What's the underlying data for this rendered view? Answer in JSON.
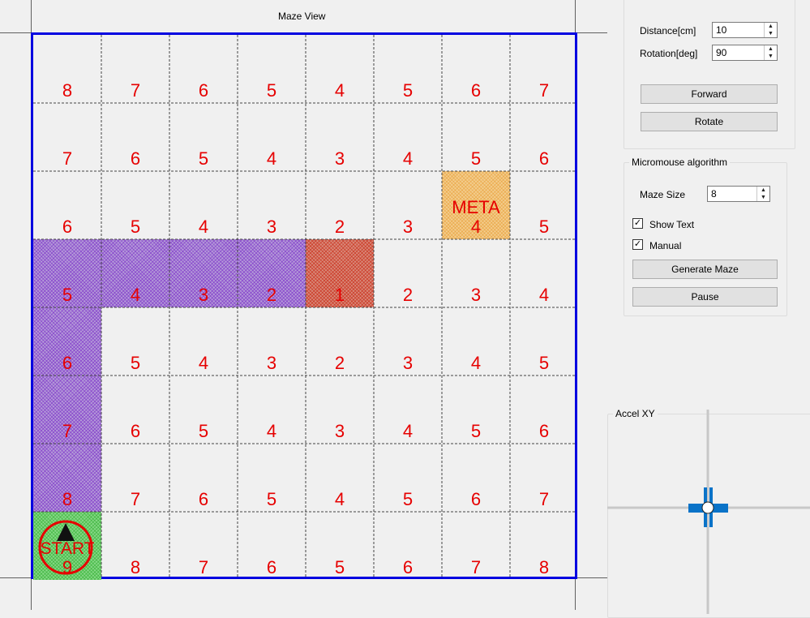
{
  "maze_view": {
    "title": "Maze View",
    "grid": [
      [
        8,
        7,
        6,
        5,
        4,
        5,
        6,
        7
      ],
      [
        7,
        6,
        5,
        4,
        3,
        4,
        5,
        6
      ],
      [
        6,
        5,
        4,
        3,
        2,
        3,
        4,
        5
      ],
      [
        5,
        4,
        3,
        2,
        1,
        2,
        3,
        4
      ],
      [
        6,
        5,
        4,
        3,
        2,
        3,
        4,
        5
      ],
      [
        7,
        6,
        5,
        4,
        3,
        4,
        5,
        6
      ],
      [
        8,
        7,
        6,
        5,
        4,
        5,
        6,
        7
      ],
      [
        9,
        8,
        7,
        6,
        5,
        6,
        7,
        8
      ]
    ],
    "meta_label": "META",
    "start_label": "START",
    "colors": {
      "border": "#0000e0",
      "number": "#e60000",
      "path": "#b49bd8",
      "current": "#d98a7a",
      "goal": "#f3cd8d",
      "start": "#86d886"
    }
  },
  "movement": {
    "distance_label": "Distance[cm]",
    "distance_value": "10",
    "rotation_label": "Rotation[deg]",
    "rotation_value": "90",
    "forward_label": "Forward",
    "rotate_label": "Rotate"
  },
  "algorithm": {
    "group_title": "Micromouse algorithm",
    "maze_size_label": "Maze Size",
    "maze_size_value": "8",
    "show_text_label": "Show Text",
    "show_text_checked": true,
    "manual_label": "Manual",
    "manual_checked": true,
    "generate_label": "Generate Maze",
    "pause_label": "Pause"
  },
  "accel": {
    "title": "Accel XY",
    "indicator_color": "#0a73c8"
  }
}
